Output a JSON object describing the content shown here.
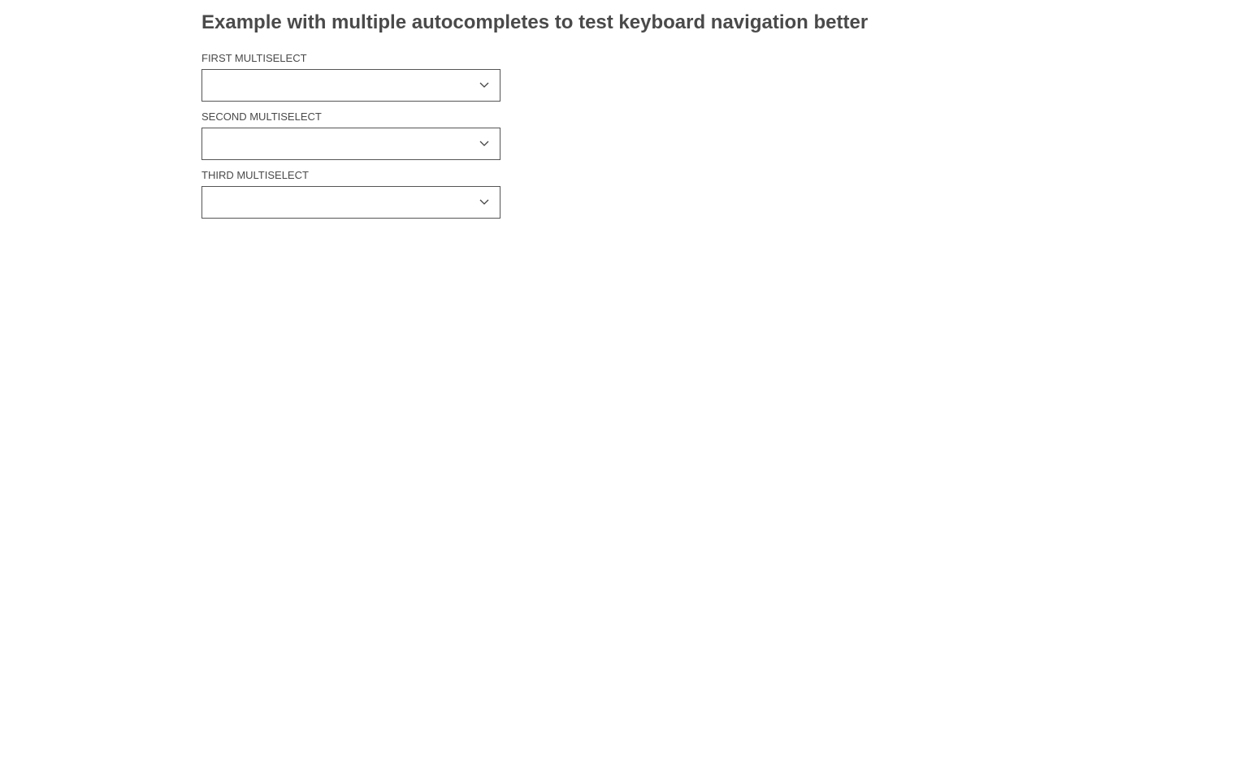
{
  "page": {
    "title": "Example with multiple autocompletes to test keyboard navigation better"
  },
  "fields": [
    {
      "label": "FIRST MULTISELECT",
      "value": "",
      "icon": "chevron-down-icon"
    },
    {
      "label": "SECOND MULTISELECT",
      "value": "",
      "icon": "chevron-down-icon"
    },
    {
      "label": "THIRD MULTISELECT",
      "value": "",
      "icon": "chevron-down-icon"
    }
  ],
  "colors": {
    "text": "#4a4a4a",
    "border": "#555555",
    "background": "#ffffff"
  }
}
